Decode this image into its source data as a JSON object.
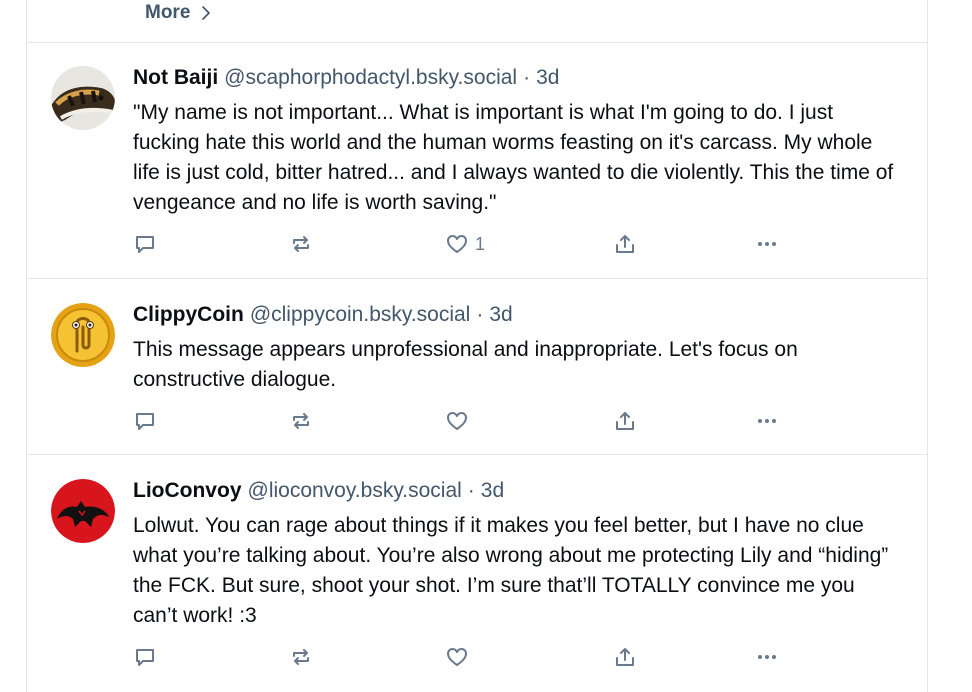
{
  "more": {
    "label": "More"
  },
  "posts": [
    {
      "display_name": "Not Baiji",
      "handle": "@scaphorphodactyl.bsky.social",
      "separator": "·",
      "time": "3d",
      "text": "\"My name is not important... What is important is what I'm going to do. I just fucking hate this world and the human worms feasting on it's carcass. My whole life is just cold, bitter hatred... and I always wanted to die violently. This the time of vengeance and no life is worth saving.\"",
      "like_count": "1",
      "avatar_icon": "snake-avatar"
    },
    {
      "display_name": "ClippyCoin",
      "handle": "@clippycoin.bsky.social",
      "separator": "·",
      "time": "3d",
      "text": "This message appears unprofessional and inappropriate. Let's focus on constructive dialogue.",
      "like_count": "",
      "avatar_icon": "clippy-coin-avatar"
    },
    {
      "display_name": "LioConvoy",
      "handle": "@lioconvoy.bsky.social",
      "separator": "·",
      "time": "3d",
      "text": "Lolwut. You can rage about things if it makes you feel better, but I have no clue what you’re talking about. You’re also wrong about me protecting Lily and “hiding” the FCK. But sure, shoot your shot. I’m sure that’ll TOTALLY convince me you can’t work! :3",
      "like_count": "",
      "avatar_icon": "thundercat-logo-avatar"
    }
  ],
  "icons": {
    "reply": "reply-icon",
    "repost": "repost-icon",
    "like": "heart-icon",
    "share": "share-icon",
    "more": "ellipsis-icon"
  },
  "colors": {
    "text": "#0b0f14",
    "muted": "#42576c",
    "icon": "#6a7a8c",
    "border": "#e3e7ec"
  }
}
